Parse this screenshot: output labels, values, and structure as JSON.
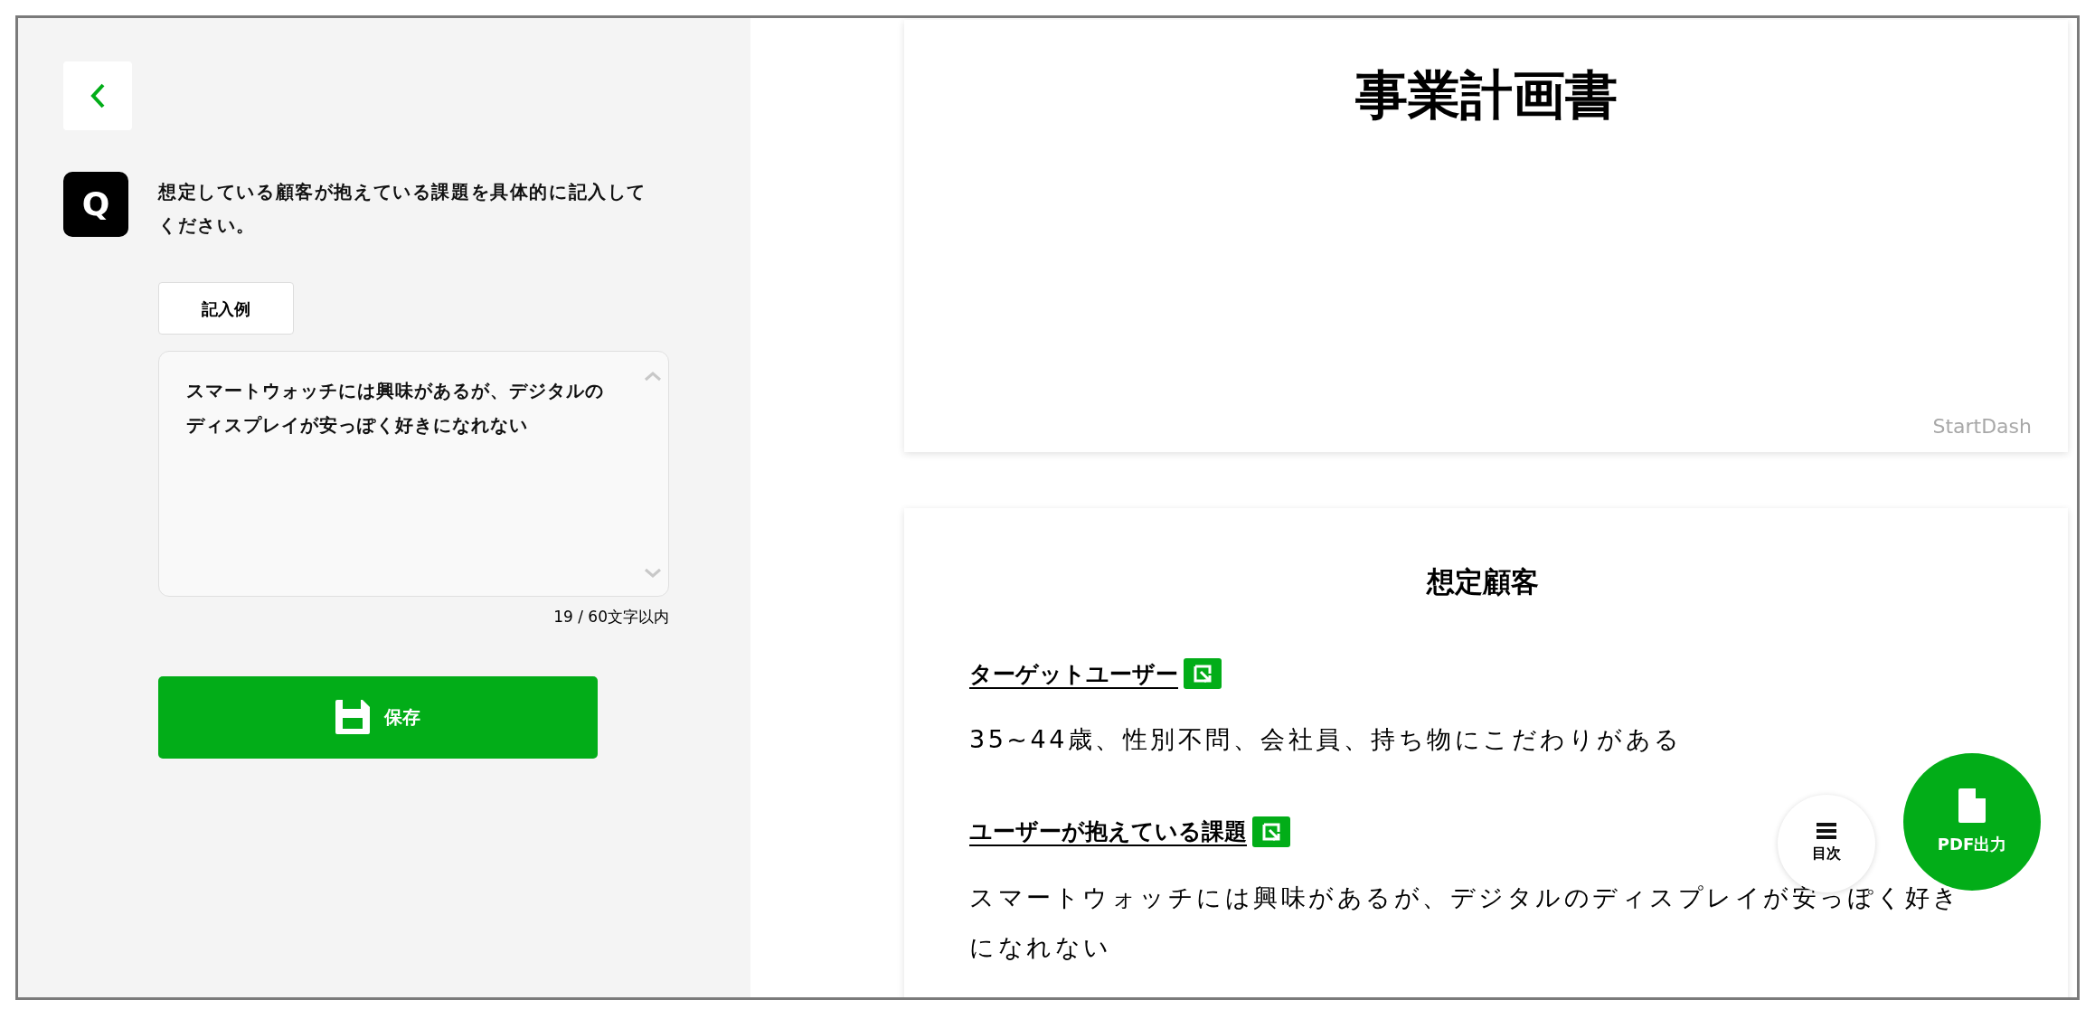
{
  "question": {
    "badge": "Q",
    "text": "想定している顧客が抱えている課題を具体的に記入してください。"
  },
  "example_button": "記入例",
  "answer": {
    "value": "スマートウォッチには興味があるが、デジタルのディスプレイが安っぽく好きになれない",
    "counter": "19 / 60文字以内"
  },
  "save_button": "保存",
  "document": {
    "cover": {
      "title": "事業計画書",
      "brand": "StartDash"
    },
    "sections": [
      {
        "title": "想定顧客",
        "items": [
          {
            "heading": "ターゲットユーザー",
            "body": "35~44歳、性別不問、会社員、持ち物にこだわりがある"
          },
          {
            "heading": "ユーザーが抱えている課題",
            "body": "スマートウォッチには興味があるが、デジタルのディスプレイが安っぽく好きになれない"
          }
        ]
      }
    ]
  },
  "fabs": [
    {
      "kind": "toc",
      "label": "目次"
    },
    {
      "kind": "pdf",
      "label": "PDF出力"
    }
  ]
}
